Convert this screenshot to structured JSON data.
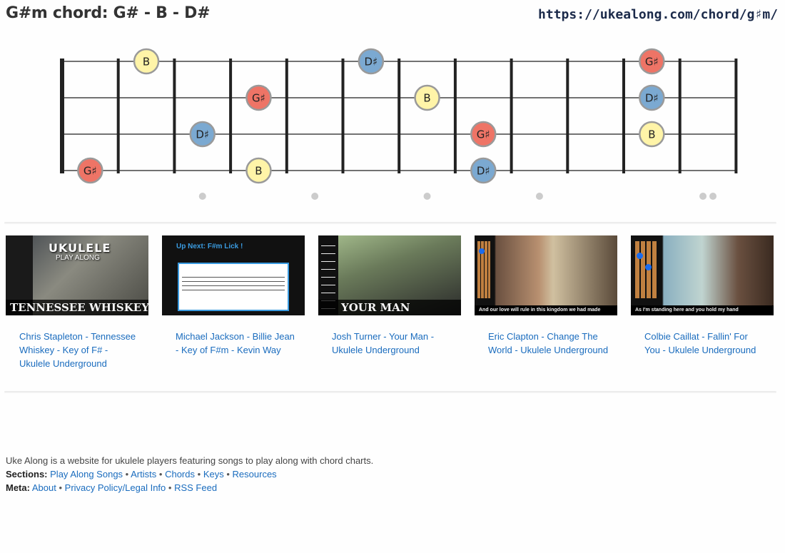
{
  "page": {
    "title": "G#m chord: G# - B - D#",
    "url": "https://ukealong.com/chord/g♯m/"
  },
  "fretboard": {
    "strings": 4,
    "frets": 12,
    "notes": [
      {
        "string": 1,
        "fret": 2,
        "name": "B",
        "color": "#fff4a8"
      },
      {
        "string": 1,
        "fret": 6,
        "name": "D♯",
        "color": "#7ba9d1"
      },
      {
        "string": 1,
        "fret": 11,
        "name": "G♯",
        "color": "#ee7466"
      },
      {
        "string": 2,
        "fret": 4,
        "name": "G♯",
        "color": "#ee7466"
      },
      {
        "string": 2,
        "fret": 7,
        "name": "B",
        "color": "#fff4a8"
      },
      {
        "string": 2,
        "fret": 11,
        "name": "D♯",
        "color": "#7ba9d1"
      },
      {
        "string": 3,
        "fret": 3,
        "name": "D♯",
        "color": "#7ba9d1"
      },
      {
        "string": 3,
        "fret": 8,
        "name": "G♯",
        "color": "#ee7466"
      },
      {
        "string": 3,
        "fret": 11,
        "name": "B",
        "color": "#fff4a8"
      },
      {
        "string": 4,
        "fret": 1,
        "name": "G♯",
        "color": "#ee7466"
      },
      {
        "string": 4,
        "fret": 4,
        "name": "B",
        "color": "#fff4a8"
      },
      {
        "string": 4,
        "fret": 8,
        "name": "D♯",
        "color": "#7ba9d1"
      }
    ],
    "inlay_markers": [
      3,
      5,
      7,
      9,
      12
    ]
  },
  "videos": [
    {
      "title": "Chris Stapleton - Tennessee Whiskey - Key of F# - Ukulele Underground",
      "thumb_text": "TENNESSEE WHISKEY"
    },
    {
      "title": "Michael Jackson - Billie Jean - Key of F#m - Kevin Way",
      "thumb_text": "Up Next: F#m Lick !"
    },
    {
      "title": "Josh Turner - Your Man - Ukulele Underground",
      "thumb_text": "YOUR MAN"
    },
    {
      "title": "Eric Clapton - Change The World - Ukulele Underground",
      "thumb_text": "And our love will rule in this kingdom we had made"
    },
    {
      "title": "Colbie Caillat - Fallin' For You - Ukulele Underground",
      "thumb_text": "As I'm standing here and you hold my hand"
    }
  ],
  "footer": {
    "description": "Uke Along is a website for ukulele players featuring songs to play along with chord charts.",
    "sections_label": "Sections:",
    "sections": [
      "Play Along Songs",
      "Artists",
      "Chords",
      "Keys",
      "Resources"
    ],
    "meta_label": "Meta:",
    "meta": [
      "About",
      "Privacy Policy/Legal Info",
      "RSS Feed"
    ],
    "separator": "•"
  }
}
